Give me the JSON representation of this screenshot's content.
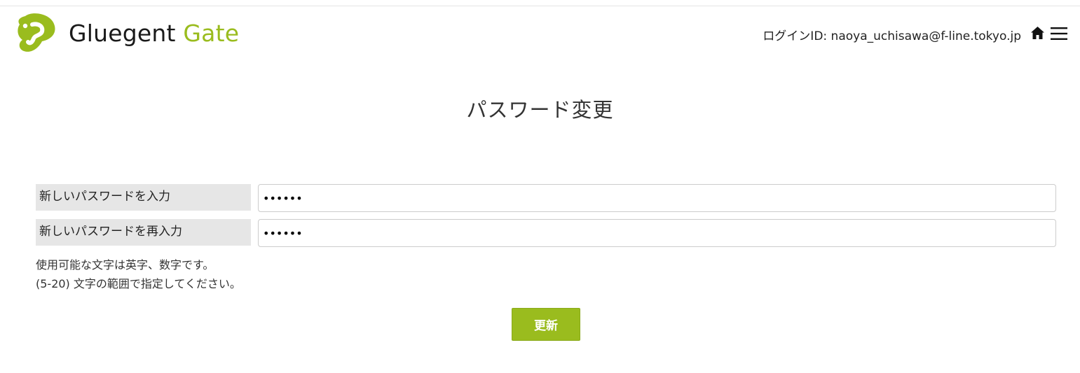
{
  "header": {
    "logo": {
      "brand_main": "Gluegent",
      "brand_accent": "Gate",
      "icon": "gluegent-logo-mark",
      "accent_color": "#9abc1e"
    },
    "login_id_text": "ログインID: naoya_uchisawa@f-line.tokyo.jp",
    "home_icon": "home-icon",
    "menu_icon": "hamburger-menu-icon"
  },
  "page": {
    "title": "パスワード変更"
  },
  "form": {
    "new_password": {
      "label": "新しいパスワードを入力",
      "value": "••••••"
    },
    "confirm_password": {
      "label": "新しいパスワードを再入力",
      "value": "••••••"
    },
    "help_lines": [
      "使用可能な文字は英字、数字です。",
      "(5-20) 文字の範囲で指定してください。"
    ],
    "submit_label": "更新",
    "submit_color": "#9abc1e"
  }
}
